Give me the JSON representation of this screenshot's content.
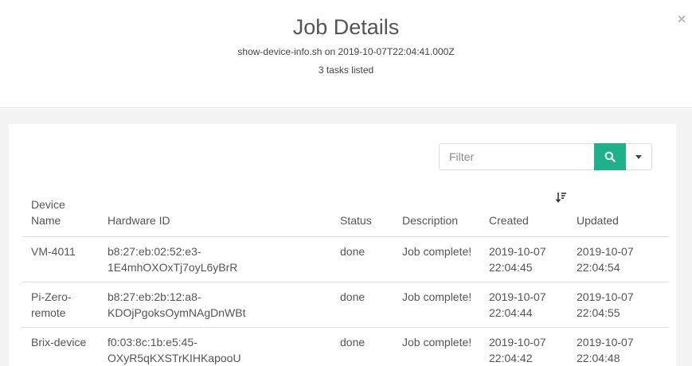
{
  "modal": {
    "title": "Job Details",
    "subtitle": "show-device-info.sh on 2019-10-07T22:04:41.000Z",
    "task_count": "3 tasks listed",
    "close_label": "×"
  },
  "filter": {
    "placeholder": "Filter",
    "search_icon": "search-icon",
    "dropdown_icon": "caret-down-icon",
    "accent_color": "#1fb28a"
  },
  "table": {
    "columns": {
      "device_name_line1": "Device",
      "device_name_line2": "Name",
      "hardware_id": "Hardware ID",
      "status": "Status",
      "description": "Description",
      "created": "Created",
      "updated": "Updated"
    },
    "sort_icon": "sort-descending-icon",
    "rows": [
      {
        "device_line1": "VM-4011",
        "device_line2": "",
        "hw_line1": "b8:27:eb:02:52:e3-1E4mhOXOxTj7oyL6yBrR",
        "hw_line2": "",
        "status": "done",
        "description": "Job complete!",
        "created_date": "2019-10-07",
        "created_time": "22:04:45",
        "updated_date": "2019-10-07",
        "updated_time": "22:04:54"
      },
      {
        "device_line1": "Pi-Zero-",
        "device_line2": "remote",
        "hw_line1": "b8:27:eb:2b:12:a8-",
        "hw_line2": "KDOjPgoksOymNAgDnWBt",
        "status": "done",
        "description": "Job complete!",
        "created_date": "2019-10-07",
        "created_time": "22:04:44",
        "updated_date": "2019-10-07",
        "updated_time": "22:04:55"
      },
      {
        "device_line1": "Brix-device",
        "device_line2": "",
        "hw_line1": "f0:03:8c:1b:e5:45-OXyR5qKXSTrKIHKapooU",
        "hw_line2": "",
        "status": "done",
        "description": "Job complete!",
        "created_date": "2019-10-07",
        "created_time": "22:04:42",
        "updated_date": "2019-10-07",
        "updated_time": "22:04:48"
      }
    ]
  }
}
